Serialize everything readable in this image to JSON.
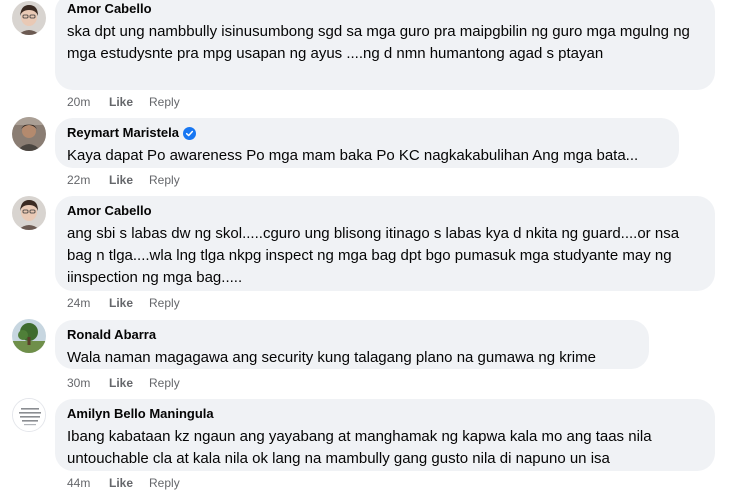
{
  "comments": [
    {
      "author": "Amor Cabello",
      "avatar": "woman-with-glasses-avatar",
      "verified": false,
      "text": "ska dpt ung nambbully isinusumbong sgd sa mga guro pra maipgbilin ng guro mga mgulng ng mga estudysnte pra mpg usapan ng ayus ....ng d nmn humantong agad s ptayan",
      "time": "20m",
      "like": "Like",
      "reply": "Reply"
    },
    {
      "author": "Reymart Maristela",
      "avatar": "man-photo-avatar",
      "verified": true,
      "text": "Kaya dapat Po awareness Po mga mam baka Po KC nagkakabulihan Ang mga bata...",
      "time": "22m",
      "like": "Like",
      "reply": "Reply"
    },
    {
      "author": "Amor Cabello",
      "avatar": "woman-with-glasses-avatar",
      "verified": false,
      "text": "ang sbi s labas dw ng skol.....cguro ung blisong itinago s labas kya d nkita ng guard....or nsa bag n tlga....wla lng tlga nkpg inspect ng mga bag dpt bgo pumasuk mga studyante may ng iinspection ng mga bag.....",
      "time": "24m",
      "like": "Like",
      "reply": "Reply"
    },
    {
      "author": "Ronald Abarra",
      "avatar": "tree-photo-avatar",
      "verified": false,
      "text": "Wala naman magagawa ang security kung talagang plano na gumawa ng krime",
      "time": "30m",
      "like": "Like",
      "reply": "Reply"
    },
    {
      "author": "Amilyn Bello Maningula",
      "avatar": "text-graphic-avatar",
      "verified": false,
      "text": "Ibang kabataan kz ngaun ang yayabang at manghamak ng kapwa kala mo ang taas nila untouchable cla at kala nila ok lang na mambully gang gusto nila di napuno un isa",
      "time": "44m",
      "like": "Like",
      "reply": "Reply"
    }
  ],
  "colors": {
    "bubble": "#f0f2f5",
    "meta": "#65676b",
    "verified": "#1877f2"
  }
}
